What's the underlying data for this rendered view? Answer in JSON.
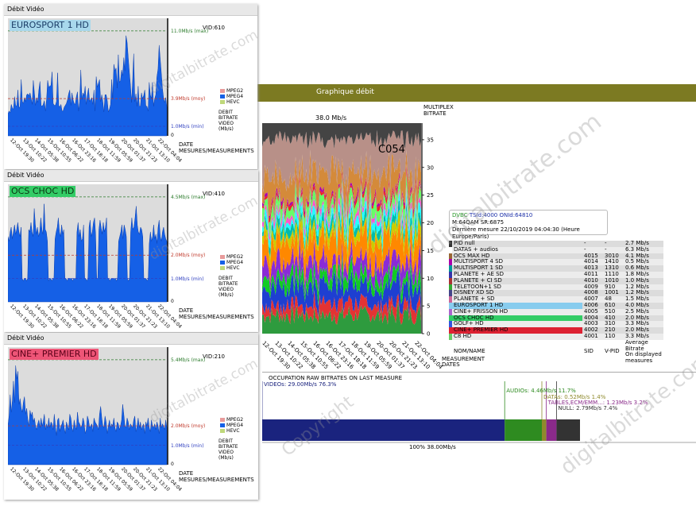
{
  "panels": [
    {
      "header": "Débit Vidéo",
      "channel": "EUROSPORT 1 HD",
      "channel_bg": "#a8d8ec",
      "channel_color": "#1a3c66",
      "vid_label": "VID:610",
      "max_label": "11.0Mb/s (max)",
      "moy_label": "3.9Mb/s (moy)",
      "min_label": "1.0Mb/s (min)",
      "zero_label": "0",
      "max": 11.0,
      "moy": 3.9,
      "min": 1.0,
      "legend": [
        "MPEG2",
        "MPEG4",
        "HEVC"
      ],
      "axis_title": [
        "DEBIT",
        "BITRATE",
        "VIDEO",
        "(Mb/s)"
      ],
      "xlabel": "DATE",
      "xlabel2": "MESURES/MEASUREMENTS",
      "xticks": [
        "12-Oct 19:30",
        "13-Oct 10:22",
        "14-Oct 05:38",
        "15-Oct 10:55",
        "16-Oct 06:22",
        "16-Oct 23:16",
        "17-Oct 18:18",
        "18-Oct 11:59",
        "19-Oct 05:59",
        "20-Oct 01:37",
        "20-Oct 21:23",
        "21-Oct 13:10",
        "22-Oct 04:04"
      ],
      "series": [
        2.3,
        2.6,
        2.4,
        3.3,
        2.9,
        2.8,
        4.1,
        3.2,
        3.1,
        4.8,
        2.9,
        3.1,
        5.9,
        3.6,
        3.4,
        4.0,
        3.6,
        4.3,
        4.4,
        4.2,
        4.5,
        3.9,
        3.3,
        5.8,
        4.5,
        3.2,
        4.0,
        3.5,
        4.8,
        5.7,
        3.2,
        3.1,
        3.3,
        3.7,
        2.6,
        3.8,
        5.8,
        5.1,
        5.2,
        5.3,
        6.7,
        3.4,
        3.2,
        3.2,
        3.6,
        6.6,
        3.2,
        3.0,
        3.3,
        2.6,
        2.6,
        3.0,
        3.2,
        3.4,
        3.8,
        4.4,
        4.8,
        3.2,
        4.5,
        3.8,
        3.4,
        3.3,
        4.1,
        4.6,
        2.6,
        3.6,
        6.9,
        3.8,
        4.5,
        4.2,
        5.2,
        3.3,
        4.3,
        5.0,
        3.6,
        3.8,
        4.0,
        3.3,
        4.8,
        2.6,
        6.2,
        5.1,
        5.5,
        5.9,
        3.6,
        4.3,
        3.6,
        2.5,
        4.3,
        4.3,
        3.7,
        2.5,
        2.8,
        3.3,
        5.9,
        3.9,
        7.5,
        6.8,
        7.1,
        5.0,
        8.5,
        5.6,
        5.8,
        6.9,
        6.3,
        8.2,
        6.8,
        10.5,
        9.8,
        8.2,
        6.7,
        5.3,
        3.5,
        5.7,
        8.6,
        3.6,
        4.4,
        3.1,
        5.2,
        3.1,
        3.1,
        4.5,
        3.9,
        4.2,
        4.8,
        3.1,
        3.1,
        2.6,
        5.6,
        4.3,
        3.9,
        5.6,
        3.1,
        3.9,
        4.3,
        6.2,
        7.0,
        9.5,
        8.0,
        6.5,
        5.0,
        4.0,
        3.5,
        4.0,
        3.0
      ]
    },
    {
      "header": "Débit Vidéo",
      "channel": "OCS CHOC HD",
      "channel_bg": "#33cc66",
      "channel_color": "#0b3311",
      "vid_label": "VID:410",
      "max_label": "4.5Mb/s (max)",
      "moy_label": "2.0Mb/s (moy)",
      "min_label": "1.0Mb/s (min)",
      "zero_label": "0",
      "max": 4.5,
      "moy": 2.0,
      "min": 1.0,
      "legend": [
        "MPEG2",
        "MPEG4",
        "HEVC"
      ],
      "axis_title": [
        "DEBIT",
        "BITRATE",
        "VIDEO",
        "(Mb/s)"
      ],
      "xlabel": "DATE",
      "xlabel2": "MESURES/MEASUREMENTS",
      "xticks": [
        "12-Oct 19:30",
        "13-Oct 10:22",
        "14-Oct 05:38",
        "15-Oct 10:55",
        "16-Oct 06:22",
        "16-Oct 23:16",
        "17-Oct 18:18",
        "18-Oct 11:59",
        "19-Oct 05:59",
        "20-Oct 01:37",
        "20-Oct 21:23",
        "21-Oct 13:10",
        "22-Oct 04:04"
      ],
      "series": [
        2.8,
        2.6,
        3.0,
        3.2,
        2.7,
        3.0,
        3.3,
        2.9,
        3.1,
        3.4,
        3.0,
        2.8,
        3.2,
        1.0,
        0.9,
        1.0,
        1.0,
        0.9,
        1.0,
        3.1,
        3.0,
        3.4,
        3.0,
        2.8,
        4.0,
        3.3,
        2.9,
        3.2,
        2.8,
        3.0,
        3.6,
        3.1,
        2.9,
        4.2,
        3.1,
        3.0,
        2.6,
        0.9,
        1.0,
        1.0,
        0.9,
        1.0,
        1.0,
        2.7,
        3.0,
        3.2,
        3.6,
        3.0,
        2.8,
        3.3,
        2.9,
        3.1,
        1.0,
        1.0,
        0.9,
        1.0,
        1.0,
        1.0,
        1.0,
        0.9,
        1.0,
        1.0,
        1.0,
        3.0,
        3.4,
        2.8,
        3.1,
        2.6,
        2.7,
        3.3,
        1.0,
        1.0,
        0.9,
        1.0,
        3.2,
        3.5,
        2.8,
        3.0,
        3.4,
        3.6,
        2.9,
        1.0,
        1.0,
        3.1,
        3.5,
        3.2,
        2.9,
        3.4,
        3.0,
        3.2,
        3.6,
        1.0,
        1.0,
        0.9,
        1.0,
        1.0,
        1.0,
        1.0,
        1.0,
        0.9,
        1.0,
        2.6,
        2.8,
        3.0,
        3.3,
        2.7,
        3.3,
        3.1,
        2.8,
        1.0,
        0.9,
        1.0,
        3.0,
        3.6,
        3.1,
        3.2,
        3.6,
        4.1,
        3.3,
        3.0,
        2.9,
        3.2,
        3.1,
        2.8,
        1.0,
        1.0,
        1.0,
        0.9,
        1.0,
        2.5,
        3.0,
        2.6,
        2.8,
        3.3,
        2.7,
        2.9,
        2.5,
        3.2,
        3.5,
        2.8,
        2.6,
        3.0,
        3.2,
        2.9,
        2.7,
        2.6
      ]
    },
    {
      "header": "Débit Vidéo",
      "channel": "CINE+ PREMIER HD",
      "channel_bg": "#ee5577",
      "channel_color": "#5a0018",
      "vid_label": "VID:210",
      "max_label": "5.4Mb/s (max)",
      "moy_label": "2.0Mb/s (moy)",
      "min_label": "1.0Mb/s (min)",
      "zero_label": "0",
      "max": 5.4,
      "moy": 2.0,
      "min": 1.0,
      "legend": [
        "MPEG2",
        "MPEG4",
        "HEVC"
      ],
      "axis_title": [
        "DEBIT",
        "BITRATE",
        "VIDEO",
        "(Mb/s)"
      ],
      "xlabel": "DATE",
      "xlabel2": "MESURES/MEASUREMENTS",
      "xticks": [
        "12-Oct 19:30",
        "13-Oct 10:22",
        "14-Oct 05:38",
        "15-Oct 10:55",
        "16-Oct 06:22",
        "16-Oct 23:16",
        "17-Oct 18:18",
        "18-Oct 11:59",
        "19-Oct 05:59",
        "20-Oct 01:37",
        "20-Oct 21:23",
        "21-Oct 13:10",
        "22-Oct 04:04"
      ],
      "series": [
        2.0,
        2.5,
        3.6,
        2.7,
        3.3,
        4.3,
        3.2,
        5.1,
        4.4,
        4.8,
        3.1,
        3.4,
        2.9,
        2.7,
        3.2,
        3.5,
        2.6,
        2.9,
        2.3,
        2.0,
        2.8,
        2.5,
        2.7,
        2.2,
        2.4,
        2.0,
        1.8,
        2.1,
        2.3,
        1.9,
        2.4,
        2.0,
        2.2,
        2.6,
        1.8,
        2.1,
        1.9,
        2.4,
        1.9,
        2.2,
        2.1,
        1.8,
        2.6,
        2.0,
        1.5,
        2.3,
        2.4,
        1.7,
        2.0,
        2.1,
        2.3,
        1.9,
        1.6,
        2.2,
        2.0,
        1.8,
        2.6,
        2.4,
        1.9,
        1.7,
        2.3,
        2.0,
        1.8,
        2.7,
        2.2,
        2.1,
        1.9,
        2.0,
        2.4,
        2.2,
        1.6,
        1.8,
        2.5,
        2.3,
        1.9,
        2.0,
        2.1,
        1.7,
        2.4,
        2.2,
        2.1,
        2.0,
        1.8,
        2.6,
        3.0,
        2.4,
        2.0,
        1.9,
        2.5,
        2.2,
        1.6,
        2.0,
        2.3,
        1.9,
        2.1,
        2.0,
        2.4,
        1.9,
        1.7,
        2.2,
        2.1,
        1.8,
        2.0,
        2.3,
        3.1,
        2.6,
        2.0,
        1.9,
        2.4,
        2.2,
        1.8,
        2.1,
        2.0,
        1.9,
        2.3,
        2.5,
        1.7,
        2.0,
        2.4,
        1.9,
        2.2,
        1.8,
        2.0,
        2.1,
        1.6,
        2.2,
        2.0,
        2.4,
        1.9,
        1.7,
        2.3,
        2.0,
        1.9,
        2.1,
        1.8,
        2.2,
        2.0,
        1.6,
        2.4,
        1.9,
        2.1,
        2.0,
        1.8,
        2.3,
        1.9
      ]
    }
  ],
  "graph": {
    "title": "Graphique débit",
    "header_color": "#7c7a22",
    "total_label": "38.0 Mb/s",
    "annotation": "C054",
    "right_label_1": "MULTIPLEX",
    "right_label_2": "BITRATE",
    "yticks": [
      "0",
      "5",
      "10",
      "15",
      "20",
      "25",
      "30",
      "35"
    ],
    "xlabel_1": "MEASUREMENT",
    "xlabel_2": "DATES",
    "xticks": [
      "12-Oct 19:30",
      "13-Oct 10:22",
      "14-Oct 05:38",
      "15-Oct 10:55",
      "16-Oct 06:22",
      "16-Oct 23:16",
      "17-Oct 18:18",
      "18-Oct 11:59",
      "19-Oct 05:59",
      "20-Oct 01:37",
      "20-Oct 21:23",
      "21-Oct 13:10",
      "22-Oct 04:04"
    ]
  },
  "chart_data": {
    "type": "area",
    "ylim": [
      0,
      38
    ],
    "yticks": [
      0,
      5,
      10,
      15,
      20,
      25,
      30,
      35
    ],
    "series_order_bottom_to_top": [
      {
        "name": "C8 HD",
        "color": "#2e9b3e",
        "avg": 3.3
      },
      {
        "name": "CINE+ PREMIER HD",
        "color": "#e33333",
        "avg": 2.0
      },
      {
        "name": "GOLF+ HD",
        "color": "#1e3fd1",
        "avg": 3.3
      },
      {
        "name": "OCS CHOC HD",
        "color": "#11cc22",
        "avg": 2.0
      },
      {
        "name": "CINE+ FRISSON HD",
        "color": "#8a2bd6",
        "avg": 2.5
      },
      {
        "name": "EUROSPORT 1 HD",
        "color": "#ff8800",
        "avg": 4.0
      },
      {
        "name": "PLANETE + SD",
        "color": "#cccc00",
        "avg": 1.5
      },
      {
        "name": "DISNEY XD SD",
        "color": "#00bbaa",
        "avg": 1.2
      },
      {
        "name": "TELETOON+1 SD",
        "color": "#22ffff",
        "avg": 1.2
      },
      {
        "name": "PLANETE + CI SD",
        "color": "#ff55cc",
        "avg": 1.0
      },
      {
        "name": "PLANETE + AE SD",
        "color": "#66ff66",
        "avg": 1.8
      },
      {
        "name": "MULTISPORT 1 SD",
        "color": "#ee2222",
        "avg": 0.6
      },
      {
        "name": "MULTISPORT 4 SD",
        "color": "#aa00aa",
        "avg": 0.5
      },
      {
        "name": "OCS MAX HD",
        "color": "#d48a3a",
        "avg": 4.1
      },
      {
        "name": "DATAS + audios",
        "color": "#b89088",
        "avg": 6.3
      },
      {
        "name": "PID null",
        "color": "#444444",
        "avg": 2.7
      }
    ]
  },
  "tooltip": {
    "line1_prefix": "DVBC",
    "line1_rest": " TSId:4000 ONId:64810",
    "line2": "M:64QAM SR:6875",
    "line3": "Dernière mesure 22/10/2019 04:04:30 (Heure Europe/Paris)"
  },
  "table": {
    "rows": [
      {
        "name": "PID null",
        "sid": "-",
        "vpid": "-",
        "avg": "2.7 Mb/s",
        "color": "#333333",
        "hl": ""
      },
      {
        "name": "DATAS + audios",
        "sid": "-",
        "vpid": "-",
        "avg": "6.3 Mb/s",
        "color": "#ffffff",
        "hl": ""
      },
      {
        "name": "OCS MAX HD",
        "sid": "4015",
        "vpid": "3010",
        "avg": "4.1 Mb/s",
        "color": "#996633",
        "hl": ""
      },
      {
        "name": "MULTISPORT 4 SD",
        "sid": "4014",
        "vpid": "1410",
        "avg": "0.5 Mb/s",
        "color": "#aa00aa",
        "hl": ""
      },
      {
        "name": "MULTISPORT 1 SD",
        "sid": "4013",
        "vpid": "1310",
        "avg": "0.6 Mb/s",
        "color": "#009999",
        "hl": ""
      },
      {
        "name": "PLANETE + AE SD",
        "sid": "4011",
        "vpid": "1110",
        "avg": "1.8 Mb/s",
        "color": "#3333aa",
        "hl": ""
      },
      {
        "name": "PLANETE + CI SD",
        "sid": "4010",
        "vpid": "1010",
        "avg": "1.0 Mb/s",
        "color": "#aa3333",
        "hl": ""
      },
      {
        "name": "TELETOON+1 SD",
        "sid": "4009",
        "vpid": "910",
        "avg": "1.2 Mb/s",
        "color": "#33aa33",
        "hl": ""
      },
      {
        "name": "DISNEY XD SD",
        "sid": "4008",
        "vpid": "1001",
        "avg": "1.2 Mb/s",
        "color": "#444488",
        "hl": ""
      },
      {
        "name": "PLANETE + SD",
        "sid": "4007",
        "vpid": "48",
        "avg": "1.5 Mb/s",
        "color": "#cc6699",
        "hl": ""
      },
      {
        "name": "EUROSPORT 1 HD",
        "sid": "4006",
        "vpid": "610",
        "avg": "4.0 Mb/s",
        "color": "#88ccee",
        "hl": "#88ccee"
      },
      {
        "name": "CINE+ FRISSON HD",
        "sid": "4005",
        "vpid": "510",
        "avg": "2.5 Mb/s",
        "color": "#aa66cc",
        "hl": ""
      },
      {
        "name": "OCS CHOC HD",
        "sid": "4004",
        "vpid": "410",
        "avg": "2.0 Mb/s",
        "color": "#33cc66",
        "hl": "#33cc66"
      },
      {
        "name": "GOLF+ HD",
        "sid": "4003",
        "vpid": "310",
        "avg": "3.3 Mb/s",
        "color": "#3355dd",
        "hl": ""
      },
      {
        "name": "CINE+ PREMIER HD",
        "sid": "4002",
        "vpid": "210",
        "avg": "2.0 Mb/s",
        "color": "#dd2233",
        "hl": "#dd2233"
      },
      {
        "name": "C8 HD",
        "sid": "4001",
        "vpid": "110",
        "avg": "3.3 Mb/s",
        "color": "#66cc66",
        "hl": ""
      }
    ],
    "footer_name": "NOM/NAME",
    "footer_sid": "SID",
    "footer_vpid": "V-PID",
    "footer_avg": [
      "Average",
      "Bitrate",
      "On displayed",
      "measures"
    ]
  },
  "occupation": {
    "title": "OCCUPATION RAW BITRATES ON LAST MEASURE",
    "videos_label": "VIDEOs: 29.00Mb/s  76.3%",
    "audios_label": "AUDIOs: 4.46Mb/s  11.7%",
    "datas_label": "DATAs: 0.52Mb/s  1.4%",
    "tables_label": "TABLES,ECM/EMM...: 1.23Mb/s  3.2%",
    "null_label": "NULL: 2.79Mb/s  7.4%",
    "total_label": "100%  38.00Mb/s",
    "segments": [
      {
        "name": "videos",
        "pct": 76.3,
        "color": "#1a237e"
      },
      {
        "name": "audios",
        "pct": 11.7,
        "color": "#2e8b20"
      },
      {
        "name": "datas",
        "pct": 1.4,
        "color": "#8f8a2c"
      },
      {
        "name": "tables",
        "pct": 3.2,
        "color": "#8a2a8a"
      },
      {
        "name": "null",
        "pct": 7.4,
        "color": "#333333"
      }
    ]
  },
  "watermark": "digitalbitrate.com",
  "watermark2": "Copyright"
}
